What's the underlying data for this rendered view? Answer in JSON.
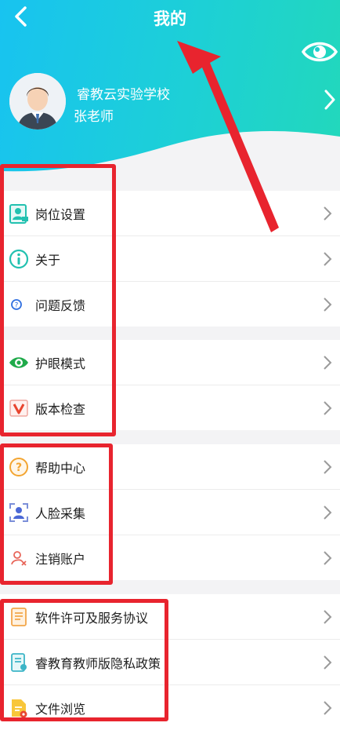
{
  "header": {
    "title": "我的",
    "profile_name": "睿教云实验学校",
    "profile_sub": "张老师"
  },
  "groups": [
    {
      "items": [
        {
          "label": "岗位设置",
          "icon": "id-card-icon"
        },
        {
          "label": "关于",
          "icon": "info-icon"
        },
        {
          "label": "问题反馈",
          "icon": "question-icon"
        }
      ]
    },
    {
      "items": [
        {
          "label": "护眼模式",
          "icon": "eye-icon"
        },
        {
          "label": "版本检查",
          "icon": "version-icon"
        }
      ]
    },
    {
      "items": [
        {
          "label": "帮助中心",
          "icon": "help-icon"
        },
        {
          "label": "人脸采集",
          "icon": "face-capture-icon"
        },
        {
          "label": "注销账户",
          "icon": "logout-user-icon"
        }
      ]
    },
    {
      "items": [
        {
          "label": "软件许可及服务协议",
          "icon": "license-doc-icon"
        },
        {
          "label": "睿教育教师版隐私政策",
          "icon": "privacy-doc-icon"
        },
        {
          "label": "文件浏览",
          "icon": "file-browse-icon"
        }
      ]
    }
  ],
  "colors": {
    "header_start": "#18c3f0",
    "header_end": "#22d8bb",
    "annotation_red": "#e8242e"
  }
}
